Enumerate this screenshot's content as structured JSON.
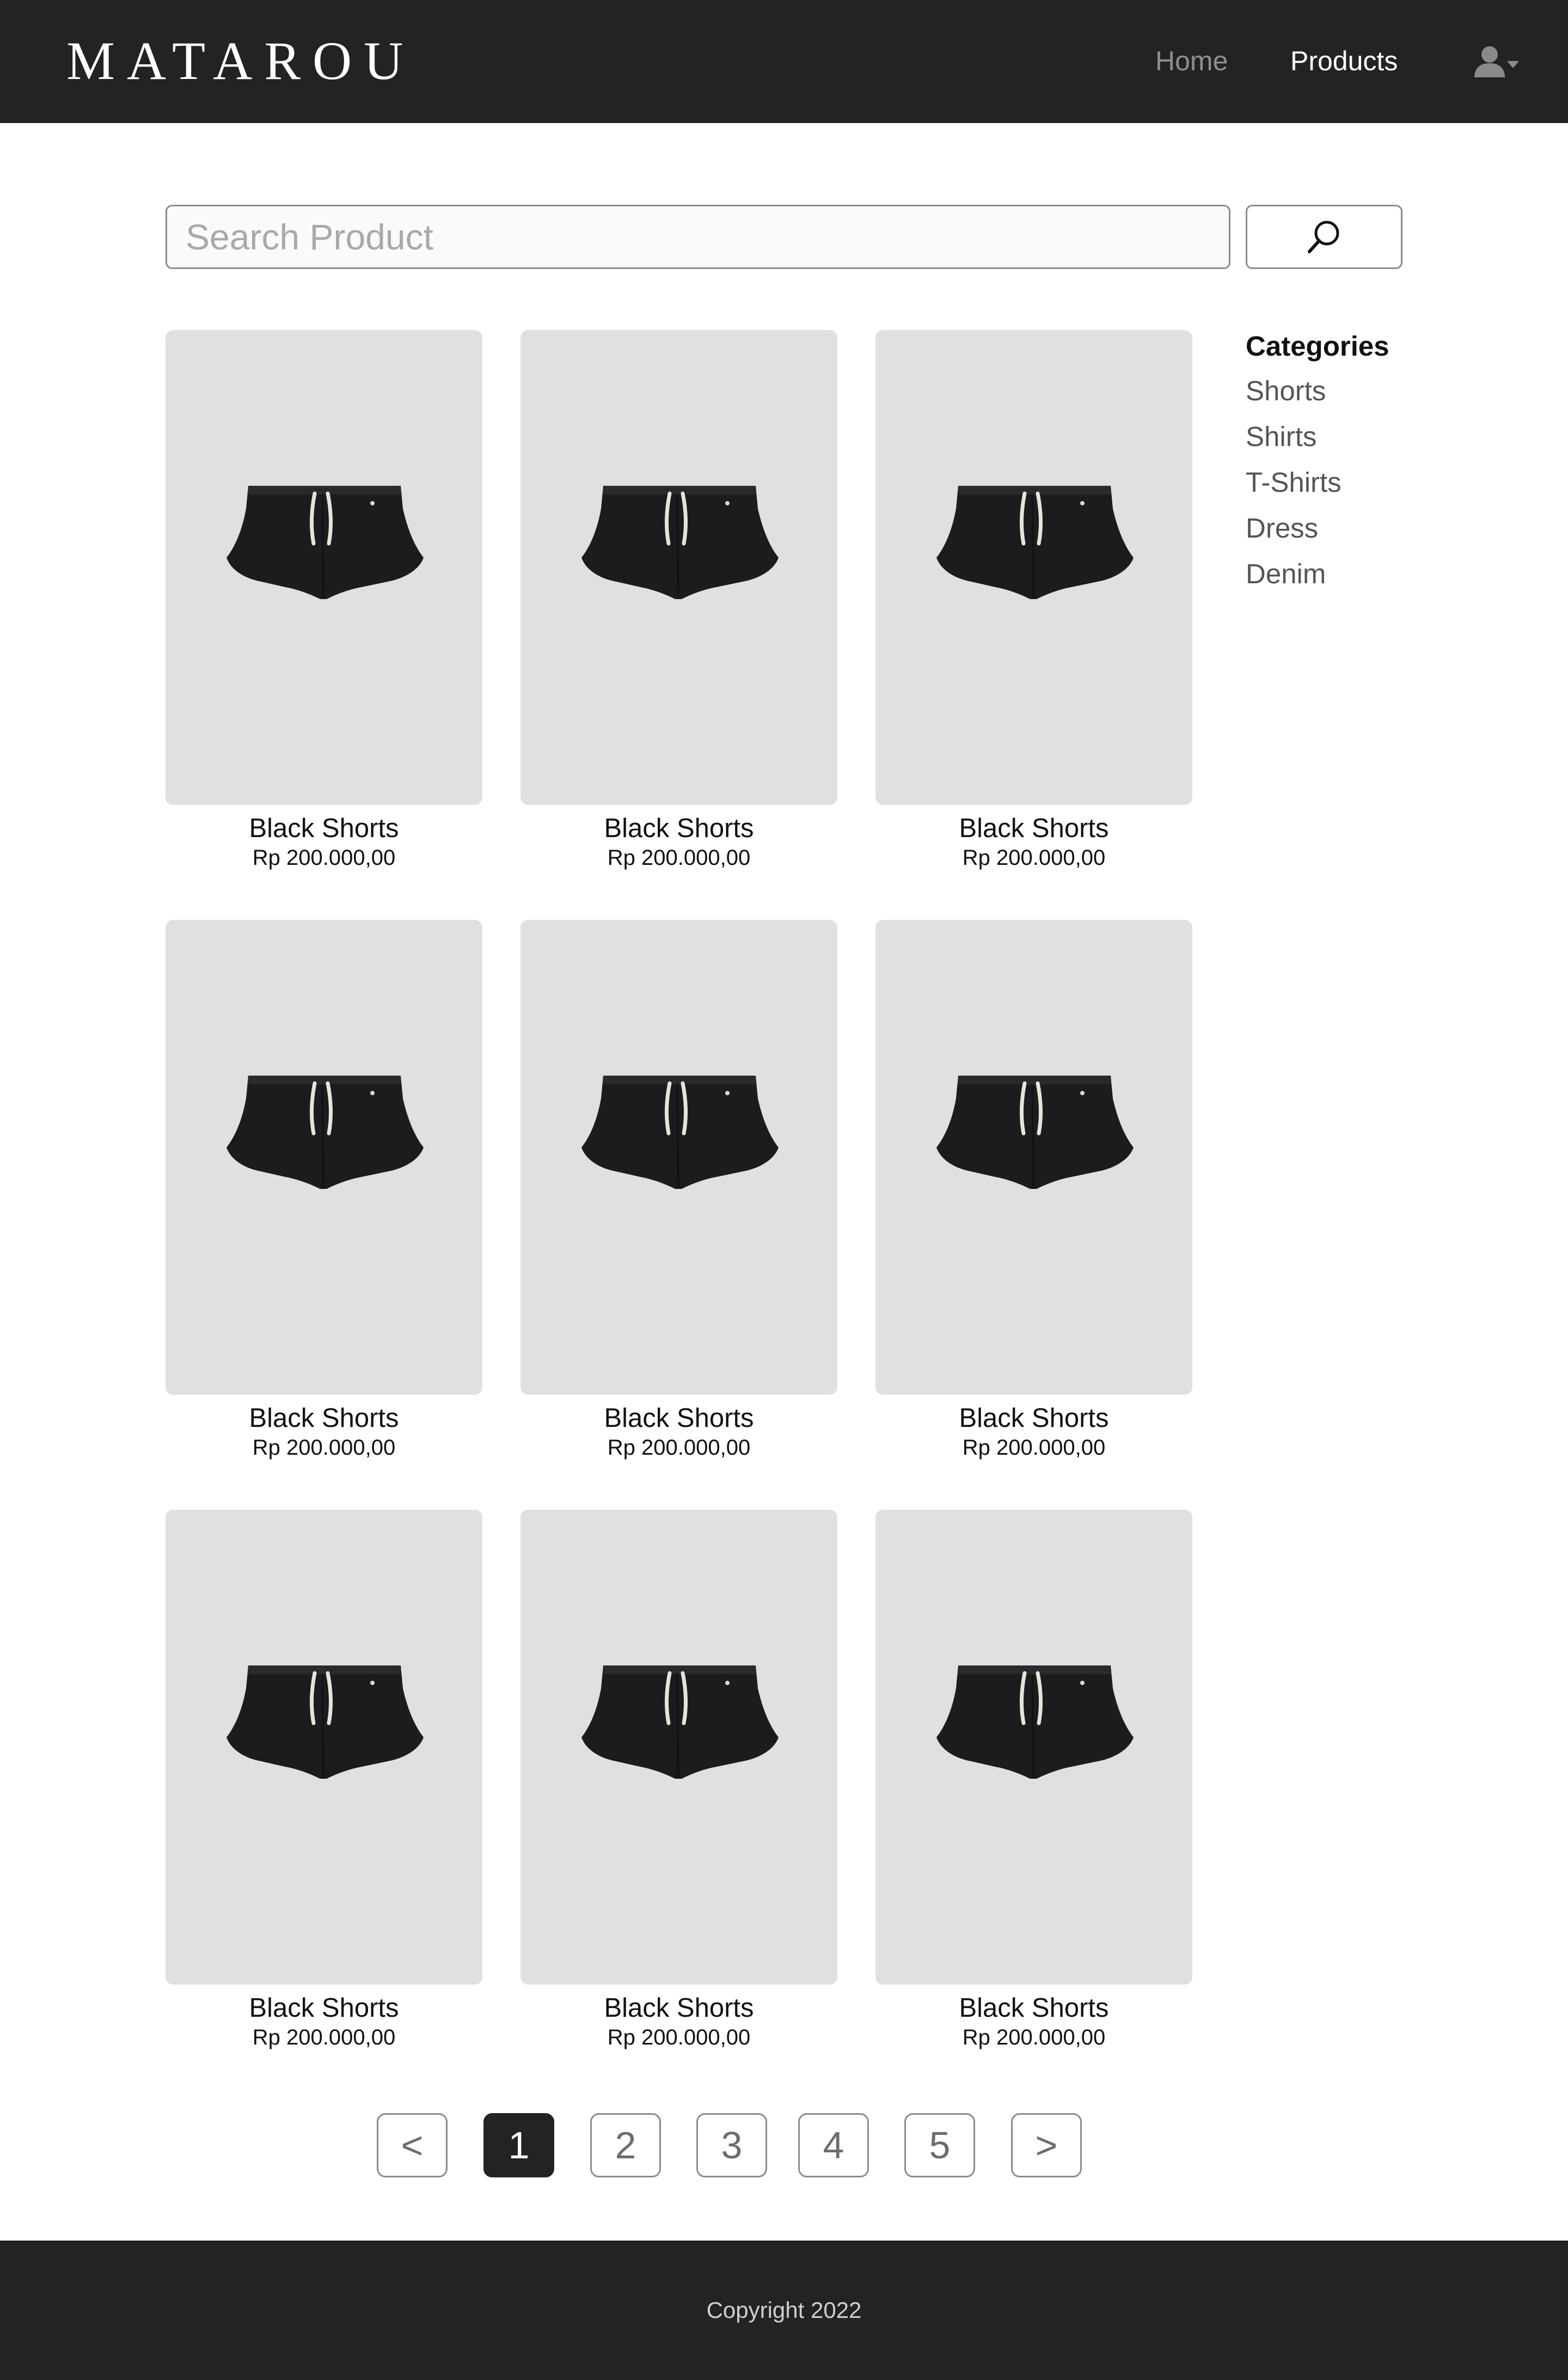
{
  "header": {
    "brand": "MATAROU",
    "nav": {
      "home": "Home",
      "products": "Products"
    },
    "user_icon": "user-icon",
    "dropdown_icon": "caret-down-icon"
  },
  "search": {
    "placeholder": "Search Product",
    "value": "",
    "icon": "search-icon"
  },
  "products": [
    {
      "name": "Black Shorts",
      "price": "Rp 200.000,00"
    },
    {
      "name": "Black Shorts",
      "price": "Rp 200.000,00"
    },
    {
      "name": "Black Shorts",
      "price": "Rp 200.000,00"
    },
    {
      "name": "Black Shorts",
      "price": "Rp 200.000,00"
    },
    {
      "name": "Black Shorts",
      "price": "Rp 200.000,00"
    },
    {
      "name": "Black Shorts",
      "price": "Rp 200.000,00"
    },
    {
      "name": "Black Shorts",
      "price": "Rp 200.000,00"
    },
    {
      "name": "Black Shorts",
      "price": "Rp 200.000,00"
    },
    {
      "name": "Black Shorts",
      "price": "Rp 200.000,00"
    }
  ],
  "categories": {
    "title": "Categories",
    "items": [
      "Shorts",
      "Shirts",
      "T-Shirts",
      "Dress",
      "Denim"
    ]
  },
  "pagination": {
    "prev": "<",
    "pages": [
      "1",
      "2",
      "3",
      "4",
      "5"
    ],
    "next": ">",
    "current": "1"
  },
  "footer": {
    "copyright": "Copyright 2022"
  },
  "colors": {
    "header_bg": "#232323",
    "footer_bg": "#232323",
    "card_bg": "#e0e0e0",
    "active_page_bg": "#232323",
    "muted_text": "#8f8f8f"
  }
}
